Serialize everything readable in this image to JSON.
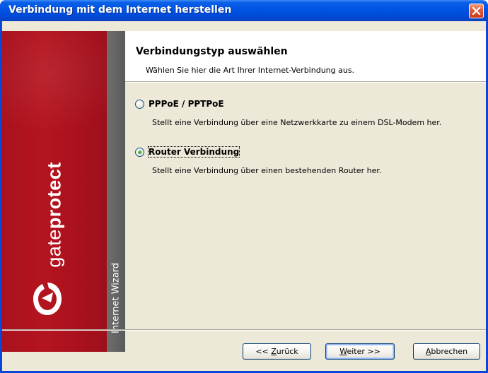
{
  "window": {
    "title": "Verbindung mit dem Internet herstellen"
  },
  "brand": {
    "name_light": "gate",
    "name_bold": "protect",
    "wizard_label": "Internet Wizard",
    "logo_icon": "gateprotect-logo-icon",
    "red_color": "#b5141f",
    "gray_color": "#5f5f5f"
  },
  "header": {
    "title": "Verbindungstyp auswählen",
    "subtitle": "Wählen Sie hier die Art Ihrer Internet-Verbindung aus."
  },
  "options": [
    {
      "label": "PPPoE / PPTPoE",
      "description": "Stellt eine Verbindung über eine Netzwerkkarte zu einem DSL-Modem her.",
      "selected": false
    },
    {
      "label": "Router Verbindung",
      "description": "Stellt eine Verbindung über einen bestehenden Router her.",
      "selected": true
    }
  ],
  "buttons": {
    "back": {
      "prefix": "<< ",
      "mnemonic": "Z",
      "rest": "urück"
    },
    "next": {
      "mnemonic": "W",
      "rest": "eiter >>"
    },
    "cancel": {
      "mnemonic": "A",
      "rest": "bbrechen"
    }
  }
}
